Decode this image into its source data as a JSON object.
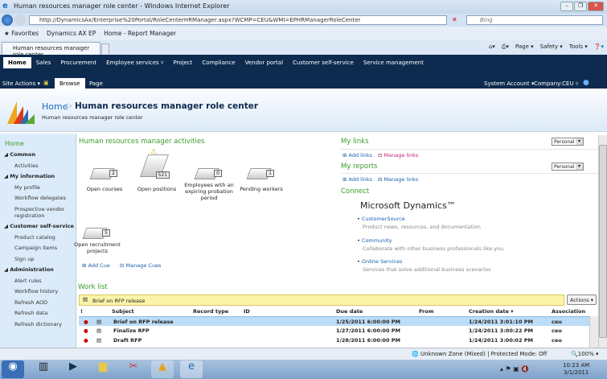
{
  "browser": {
    "title": "Human resources manager role center - Windows Internet Explorer",
    "url": "http://DynamicsAx/Enterprise%20Portal/RoleCenterHRManager.aspx?WCMP=CEU&WMI=EPHRManagerRoleCenter",
    "search_placeholder": "Bing",
    "favorites_label": "Favorites",
    "fav_items": [
      "Dynamics AX EP",
      "Home - Report Manager"
    ],
    "tab_label": "Human resources manager role center",
    "tools": [
      "Page ▾",
      "Safety ▾",
      "Tools ▾"
    ]
  },
  "topnav": {
    "items": [
      "Home",
      "Sales",
      "Procurement",
      "Employee services ▿",
      "Project",
      "Compliance",
      "Vendor portal",
      "Customer self-service",
      "Service management"
    ]
  },
  "subnav": {
    "site_actions": "Site Actions ▾",
    "browse": "Browse",
    "page": "Page",
    "account": "System Account ▾",
    "company": "Company:CEU ▿"
  },
  "header": {
    "breadcrumb_home": "Home",
    "title": "Human resources manager role center",
    "subtitle": "Human resources manager role center"
  },
  "sidebar": {
    "home": "Home",
    "sections": [
      {
        "label": "Common",
        "items": [
          "Activities"
        ]
      },
      {
        "label": "My information",
        "items": [
          "My profile",
          "Workflow delegates",
          "Prospective vendor registration"
        ]
      },
      {
        "label": "Customer self-service",
        "items": [
          "Product catalog",
          "Campaign items",
          "Sign up"
        ]
      },
      {
        "label": "Administration",
        "items": [
          "Alert rules",
          "Workflow history",
          "Refresh AOD",
          "Refresh data",
          "Refresh dictionary"
        ]
      }
    ]
  },
  "activities": {
    "title": "Human resources manager activities",
    "cues": [
      {
        "label": "Open courses",
        "count": "2"
      },
      {
        "label": "Open positions",
        "count": "521"
      },
      {
        "label": "Employees with an expiring probation period",
        "count": "0"
      },
      {
        "label": "Pending workers",
        "count": "1"
      },
      {
        "label": "Open recruitment projects",
        "count": "5"
      }
    ],
    "add_cue": "Add Cue",
    "manage_cues": "Manage Cues"
  },
  "mylinks": {
    "title": "My links",
    "select": "Personal",
    "add": "Add links",
    "manage": "Manage links"
  },
  "myreports": {
    "title": "My reports",
    "select": "Personal",
    "add": "Add links",
    "manage": "Manage links"
  },
  "connect": {
    "title": "Connect",
    "brand": "Microsoft Dynamics™",
    "items": [
      {
        "link": "CustomerSource",
        "desc": "Product news, resources, and documentation"
      },
      {
        "link": "Community",
        "desc": "Collaborate with other business professionals like you"
      },
      {
        "link": "Online Services",
        "desc": "Services that solve additional business scenarios"
      }
    ]
  },
  "worklist": {
    "title": "Work list",
    "banner": "Brief on RFP release",
    "actions": "Actions ▾",
    "columns": [
      "!",
      "Subject",
      "Record type",
      "ID",
      "Due date",
      "From",
      "Creation date ▾",
      "Association"
    ],
    "rows": [
      {
        "subject": "Brief on RFP release",
        "due": "1/25/2011 6:00:00 PM",
        "created": "1/24/2011 3:01:10 PM",
        "assoc": "ceu"
      },
      {
        "subject": "Finalize RFP",
        "due": "1/27/2011 6:00:00 PM",
        "created": "1/24/2011 3:00:22 PM",
        "assoc": "ceu"
      },
      {
        "subject": "Draft RFP",
        "due": "1/28/2011 6:00:00 PM",
        "created": "1/24/2011 3:00:02 PM",
        "assoc": "ceu"
      }
    ]
  },
  "statusbar": {
    "zone": "Unknown Zone (Mixed) | Protected Mode: Off",
    "zoom": "100%"
  },
  "taskbar": {
    "time": "10:23 AM",
    "date": "3/1/2011"
  }
}
